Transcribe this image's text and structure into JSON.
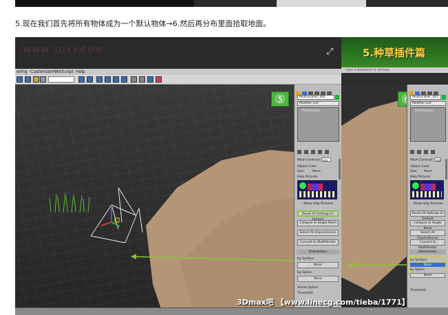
{
  "caption": "5.现在我们首先将所有物体成为一个默认物体→6.然后再分布里面拾取地面。",
  "banner": {
    "watermark": "WWW.3DXY.COM",
    "grass_title": "5.种草插件篇",
    "search_placeholder": "type a keyword or phrase"
  },
  "menubar": {
    "items": [
      "ering",
      "Customize",
      "MAXScript",
      "Help"
    ]
  },
  "panel_left": {
    "step_badge": "⑤",
    "object_name": "MultiScatter_001",
    "modifier_list": "Modifier List",
    "stack_item": "MultiScatter",
    "mesh_contrast_label": "Mesh Contrast:",
    "mesh_contrast_value": "100",
    "object_color_label": "Object Color",
    "size_label": "Size:",
    "size_value": "None",
    "help_pictures_label": "Help Pictures",
    "show_help_pictures": "Show Help Pictures",
    "reset_button": "Reset All Settings to Default",
    "collapse_button": "Collapse to Single Mesh",
    "select_dependences": "Select All Dependences",
    "convert_button": "Convert to MultiPainter",
    "distribution_label": "Distribution",
    "by_surface_label": "by Surface",
    "by_surface_value": "None",
    "by_spline_label": "by Spline",
    "by_spline_value": "None",
    "active_option": "Active Option",
    "threshold_label": "Threshold:"
  },
  "panel_right": {
    "step_badge": "⑥",
    "object_name": "MultiScatter_001",
    "modifier_list": "Modifier List",
    "stack_item": "MultiScatter",
    "mesh_contrast_label": "Mesh Contrast:",
    "mesh_contrast_value": "100",
    "object_color_label": "Object Color",
    "size_label": "Size:",
    "size_value": "None",
    "help_pictures_label": "Help Pictures",
    "show_help_pictures": "Show Help Pictures",
    "reset_button": "Reset All Settings to Default",
    "collapse_button": "Collapse to Single Mesh",
    "select_dependences": "Select All Dependences",
    "convert_button": "Convert to MultiPainter",
    "distribution_label": "Distribution",
    "by_surface_label": "by Surface",
    "by_surface_value": "None",
    "by_spline_label": "by Spline",
    "by_spline_value": "None",
    "threshold_label": "Threshold:"
  },
  "credit": "3Dmax吧 【www.linecg.com/tieba/1771】",
  "colors": {
    "accent_green": "#4fb542",
    "arrow_green": "#8ac43a",
    "highlight_yellow": "#c8d22a",
    "terrain": "#b89a78"
  }
}
